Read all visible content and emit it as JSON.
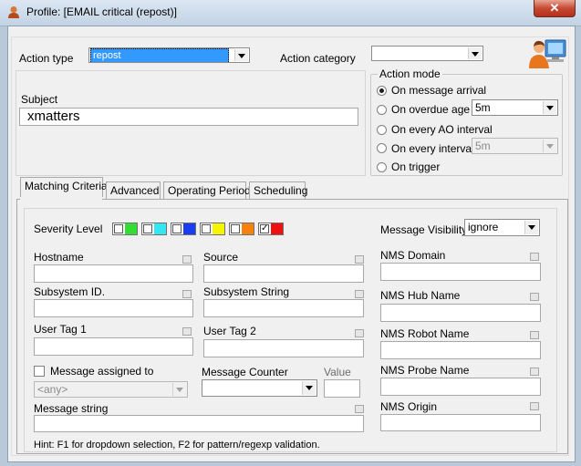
{
  "window": {
    "title": "Profile: [EMAIL critical (repost)]",
    "close_glyph": "✕"
  },
  "header": {
    "action_type_label": "Action type",
    "action_type_value": "repost",
    "action_category_label": "Action category",
    "action_category_value": "",
    "subject_label": "Subject",
    "subject_value": "xmatters"
  },
  "action_mode": {
    "legend": "Action mode",
    "on_message_arrival": "On message arrival",
    "on_overdue_age": "On overdue age",
    "overdue_age_value": "5m",
    "on_every_ao_interval": "On every AO interval",
    "on_every_interval": "On every interval",
    "every_interval_value": "5m",
    "on_trigger": "On trigger",
    "selected": "on_message_arrival"
  },
  "tabs": [
    "Matching Criteria",
    "Advanced",
    "Operating Period",
    "Scheduling"
  ],
  "criteria": {
    "severity_label": "Severity Level",
    "severity_colors": [
      "#33dd33",
      "#33e6f0",
      "#1a3df0",
      "#f5f500",
      "#f5820f",
      "#ee1111"
    ],
    "severity_checked": [
      false,
      false,
      false,
      false,
      false,
      true
    ],
    "check_glyph": "✓",
    "message_visibility_label": "Message Visibility",
    "message_visibility_value": "ignore",
    "hostname_label": "Hostname",
    "source_label": "Source",
    "nms_domain_label": "NMS Domain",
    "subsystem_id_label": "Subsystem ID.",
    "subsystem_string_label": "Subsystem String",
    "nms_hub_name_label": "NMS Hub Name",
    "user_tag1_label": "User Tag 1",
    "user_tag2_label": "User Tag 2",
    "nms_robot_name_label": "NMS Robot Name",
    "message_assigned_label": "Message assigned to",
    "assigned_value": "<any>",
    "message_counter_label": "Message Counter",
    "value_label": "Value",
    "nms_probe_name_label": "NMS Probe Name",
    "message_string_label": "Message string",
    "nms_origin_label": "NMS Origin",
    "hint": "Hint: F1 for dropdown selection, F2 for pattern/regexp validation."
  },
  "colors": {
    "selection": "#3399ff",
    "title_bar": "#c3d3e4"
  }
}
